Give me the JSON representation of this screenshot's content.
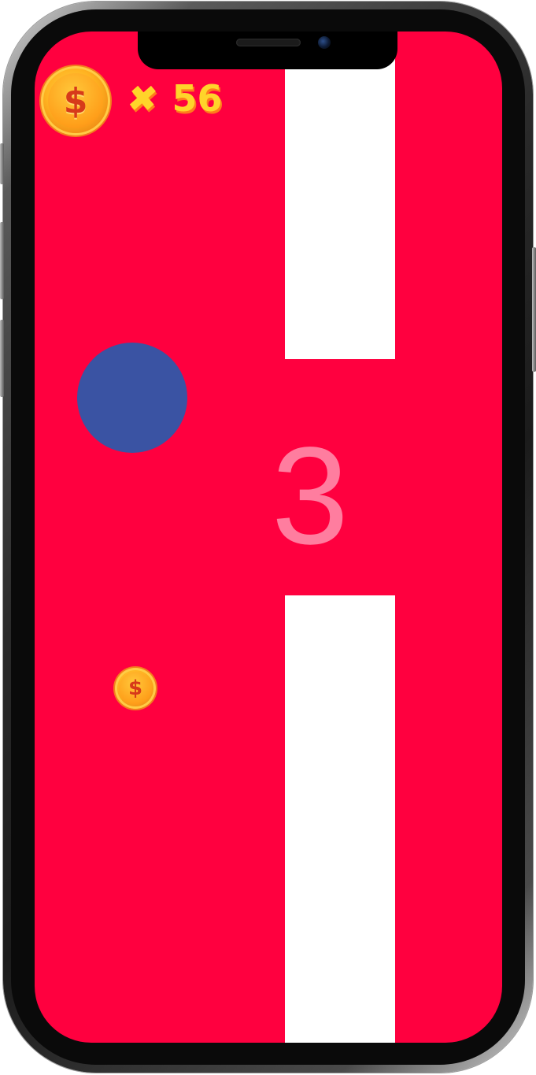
{
  "hud": {
    "coin_icon": "dollar-coin-icon",
    "coin_symbol": "$",
    "multiplier": "✖",
    "coin_count": "56"
  },
  "game": {
    "countdown": "3",
    "field_coin_symbol": "$"
  },
  "colors": {
    "background": "#ff003f",
    "walls": "#ffffff",
    "ball": "#3a53a3",
    "countdown_text": "#ff7d9f",
    "coin": "#ffb321",
    "hud_text": "#ffd42a"
  }
}
